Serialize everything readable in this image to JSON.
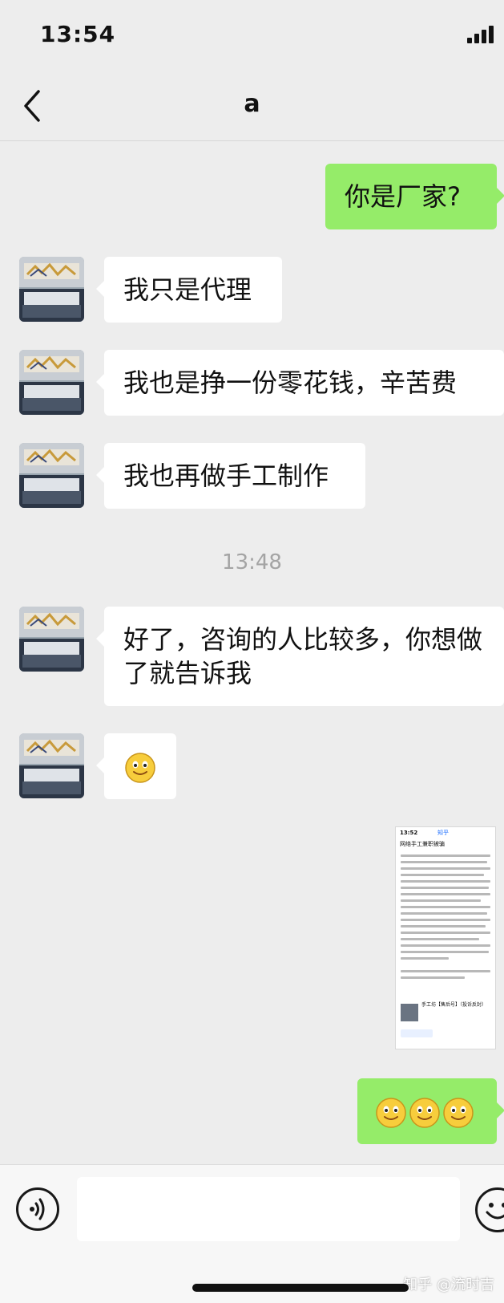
{
  "status_bar": {
    "time": "13:54"
  },
  "header": {
    "title": "a"
  },
  "messages": [
    {
      "side": "right",
      "text": "你是厂家?"
    },
    {
      "side": "left",
      "text": "我只是代理"
    },
    {
      "side": "left",
      "text": "我也是挣一份零花钱，辛苦费"
    },
    {
      "side": "left",
      "text": "我也再做手工制作"
    },
    {
      "side": "left",
      "text": "好了，咨询的人比较多，你想做了就告诉我"
    },
    {
      "side": "left",
      "emoji": "smiley"
    },
    {
      "side": "right",
      "image": "screenshot-thumbnail"
    },
    {
      "side": "right",
      "emoji": "smiley x3"
    }
  ],
  "timestamp": "13:48",
  "thumbnail": {
    "time": "13:52",
    "app": "知乎",
    "header": "网络手工兼职被骗",
    "card_title": "手工坊【售后号】（投诉反封）"
  },
  "watermark": "知乎 @流时吉",
  "input": {
    "placeholder": ""
  },
  "colors": {
    "background": "#ededed",
    "sent_bubble": "#95ec69",
    "received_bubble": "#ffffff"
  }
}
